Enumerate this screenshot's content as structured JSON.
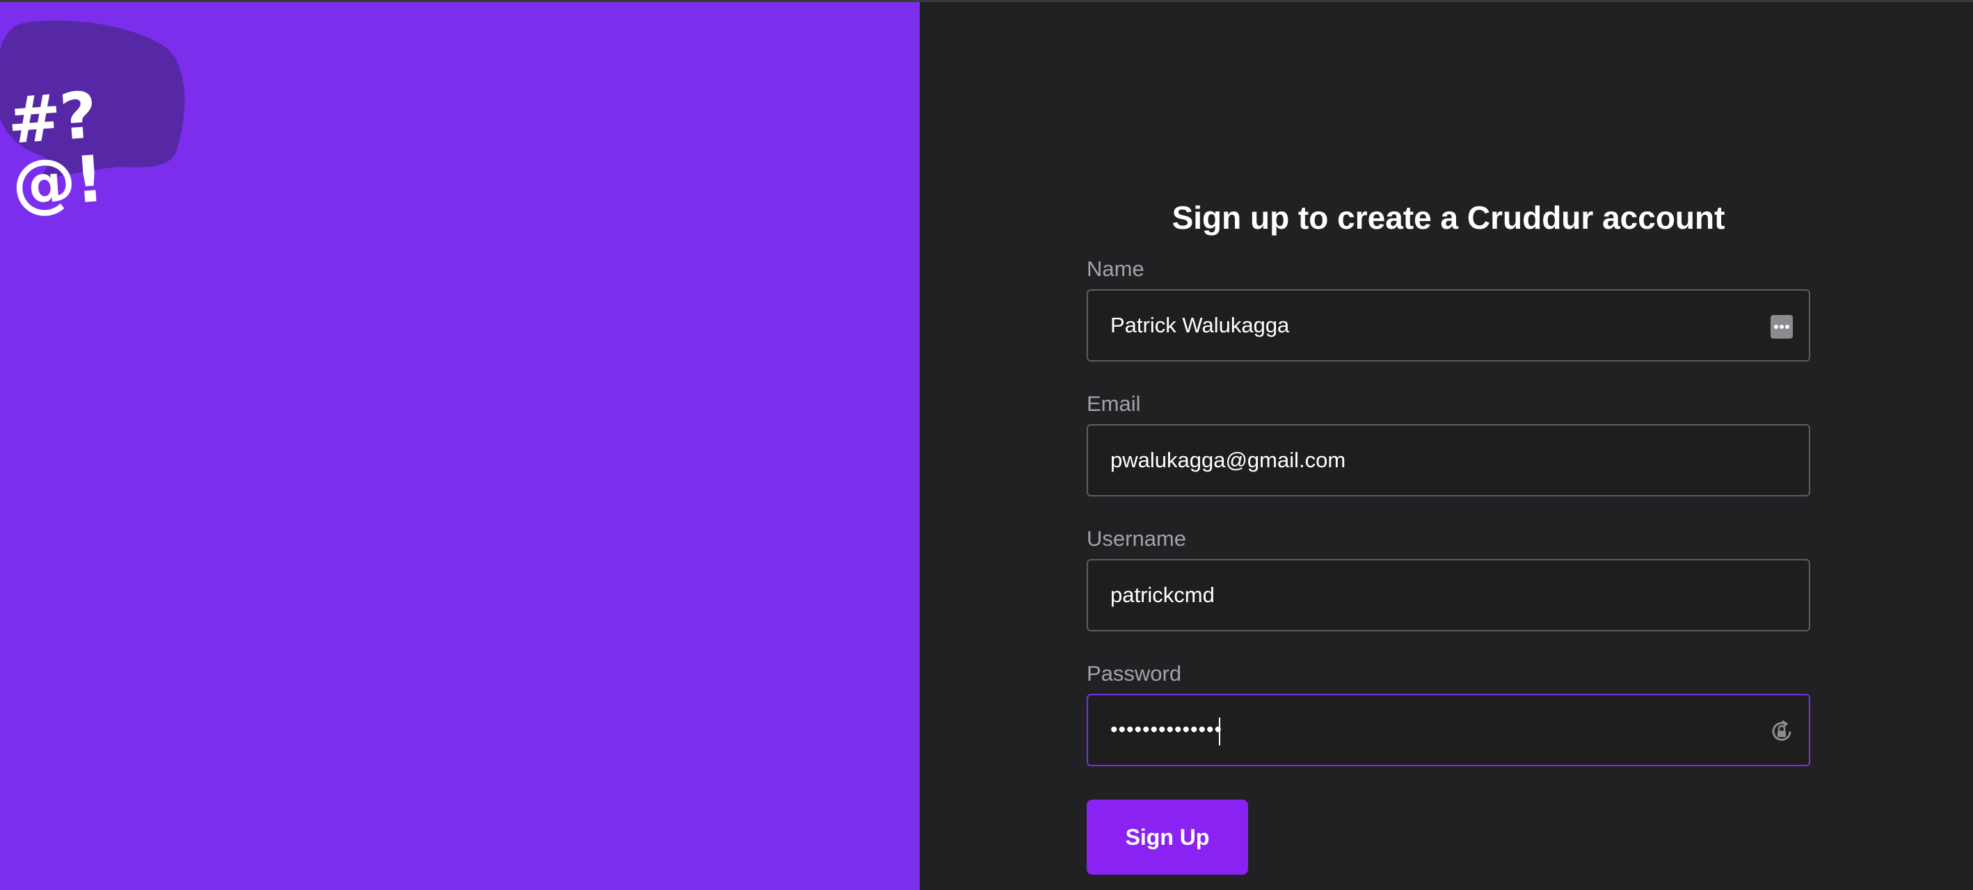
{
  "app": {
    "logo_text": "#?@!",
    "colors": {
      "brand_purple": "#7b2fec",
      "background_dark": "#212124",
      "input_background": "#1e1e1e",
      "button_purple": "#8a22f2"
    }
  },
  "form": {
    "title": "Sign up to create a Cruddur account",
    "fields": {
      "name": {
        "label": "Name",
        "value": "Patrick Walukagga",
        "icon": "password-manager-dots-icon"
      },
      "email": {
        "label": "Email",
        "value": "pwalukagga@gmail.com"
      },
      "username": {
        "label": "Username",
        "value": "patrickcmd"
      },
      "password": {
        "label": "Password",
        "value": "••••••••••••••",
        "icon": "lock-refresh-icon"
      }
    },
    "submit_label": "Sign Up"
  }
}
